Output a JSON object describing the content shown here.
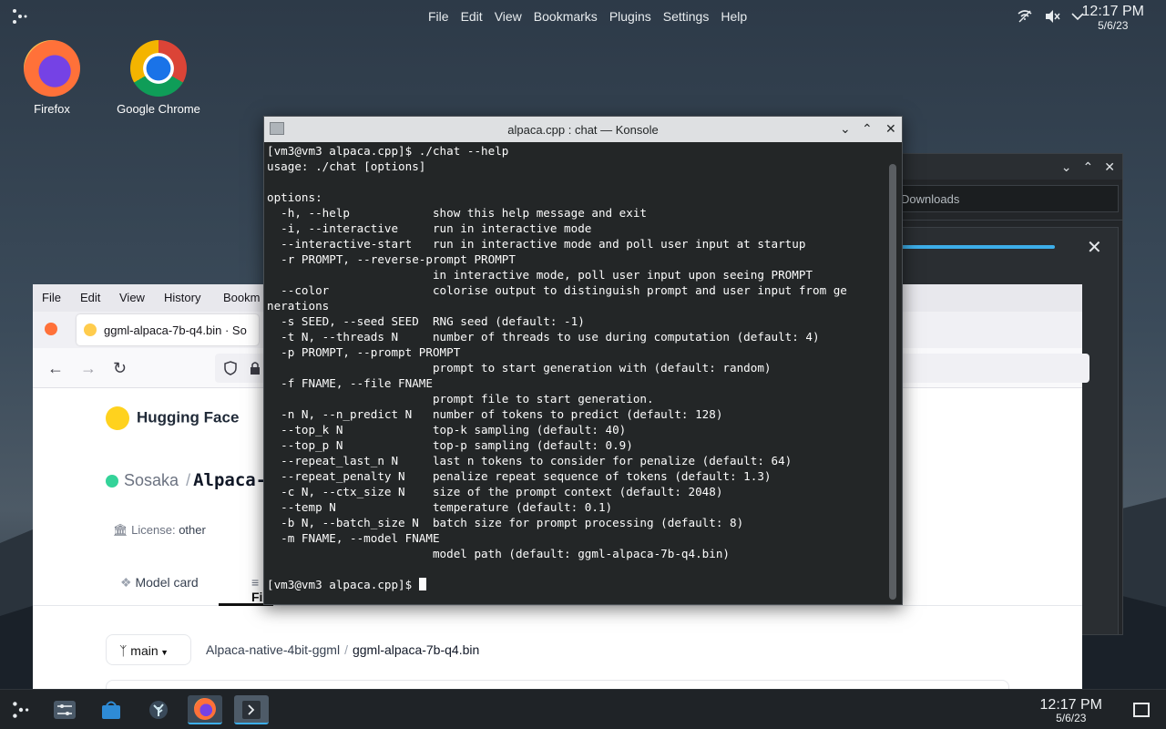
{
  "desktop": {
    "top_menu": [
      "File",
      "Edit",
      "View",
      "Bookmarks",
      "Plugins",
      "Settings",
      "Help"
    ],
    "clock_time": "12:17 PM",
    "clock_date": "5/6/23",
    "icons": [
      {
        "label": "Firefox",
        "icon": "firefox-icon"
      },
      {
        "label": "Google Chrome",
        "icon": "chrome-icon"
      }
    ]
  },
  "dolphin": {
    "address": "Downloads"
  },
  "firefox": {
    "menu": [
      "File",
      "Edit",
      "View",
      "History",
      "Bookm"
    ],
    "tab_title": "ggml-alpaca-7b-q4.bin · So",
    "site_name": "Hugging Face",
    "repo_owner": "Sosaka",
    "repo_sep": "/",
    "repo_name": "Alpaca-",
    "license_label": "License:",
    "license_value": "other",
    "tab_model_card": "Model card",
    "tab_files": "Fi",
    "branch": "main",
    "crumb_repo": "Alpaca-native-4bit-ggml",
    "crumb_sep": "/",
    "crumb_file": "ggml-alpaca-7b-q4.bin"
  },
  "konsole": {
    "title": "alpaca.cpp : chat — Konsole",
    "prompt": "[vm3@vm3 alpaca.cpp]$ ",
    "lines": [
      "[vm3@vm3 alpaca.cpp]$ ./chat --help",
      "usage: ./chat [options]",
      "",
      "options:",
      "  -h, --help            show this help message and exit",
      "  -i, --interactive     run in interactive mode",
      "  --interactive-start   run in interactive mode and poll user input at startup",
      "  -r PROMPT, --reverse-prompt PROMPT",
      "                        in interactive mode, poll user input upon seeing PROMPT",
      "  --color               colorise output to distinguish prompt and user input from ge",
      "nerations",
      "  -s SEED, --seed SEED  RNG seed (default: -1)",
      "  -t N, --threads N     number of threads to use during computation (default: 4)",
      "  -p PROMPT, --prompt PROMPT",
      "                        prompt to start generation with (default: random)",
      "  -f FNAME, --file FNAME",
      "                        prompt file to start generation.",
      "  -n N, --n_predict N   number of tokens to predict (default: 128)",
      "  --top_k N             top-k sampling (default: 40)",
      "  --top_p N             top-p sampling (default: 0.9)",
      "  --repeat_last_n N     last n tokens to consider for penalize (default: 64)",
      "  --repeat_penalty N    penalize repeat sequence of tokens (default: 1.3)",
      "  -c N, --ctx_size N    size of the prompt context (default: 2048)",
      "  --temp N              temperature (default: 0.1)",
      "  -b N, --batch_size N  batch size for prompt processing (default: 8)",
      "  -m FNAME, --model FNAME",
      "                        model path (default: ggml-alpaca-7b-q4.bin)",
      ""
    ]
  },
  "taskbar": {
    "clock_time": "12:17 PM",
    "clock_date": "5/6/23"
  }
}
